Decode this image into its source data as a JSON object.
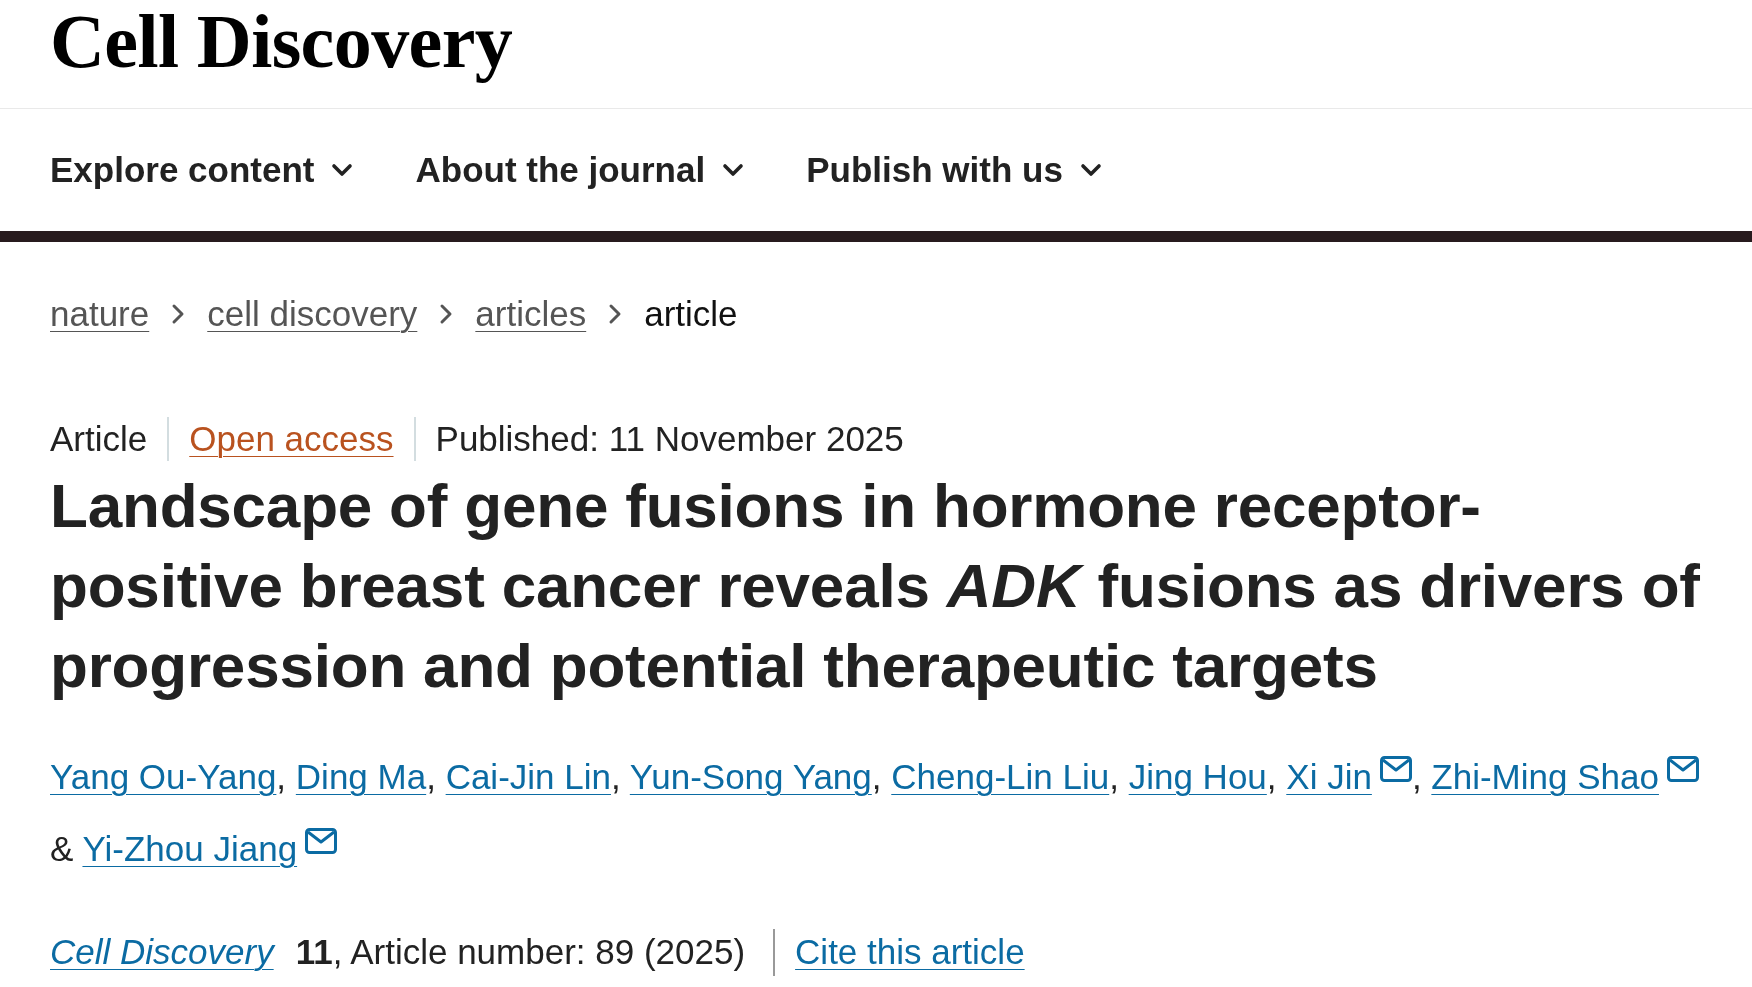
{
  "header": {
    "logo": "Cell Discovery"
  },
  "nav": [
    {
      "label": "Explore content"
    },
    {
      "label": "About the journal"
    },
    {
      "label": "Publish with us"
    }
  ],
  "breadcrumbs": [
    {
      "label": "nature",
      "current": false
    },
    {
      "label": "cell discovery",
      "current": false
    },
    {
      "label": "articles",
      "current": false
    },
    {
      "label": "article",
      "current": true
    }
  ],
  "article": {
    "meta": [
      {
        "kind": "type",
        "text": "Article"
      },
      {
        "kind": "access",
        "text": "Open access"
      },
      {
        "kind": "date",
        "text": "Published: 11 November 2025"
      }
    ],
    "title": "Landscape of gene fusions in hormone receptor-positive breast cancer reveals *ADK* fusions as drivers of progression and potential therapeutic targets",
    "authors": [
      {
        "name": "Yang Ou-Yang",
        "email": false,
        "separator": ","
      },
      {
        "name": "Ding Ma",
        "email": false,
        "separator": ","
      },
      {
        "name": "Cai-Jin Lin",
        "email": false,
        "separator": ","
      },
      {
        "name": "Yun-Song Yang",
        "email": false,
        "separator": ","
      },
      {
        "name": "Cheng-Lin Liu",
        "email": false,
        "separator": ","
      },
      {
        "name": "Jing Hou",
        "email": false,
        "separator": ","
      },
      {
        "name": "Xi Jin",
        "email": true,
        "separator": ","
      },
      {
        "name": "Zhi-Ming Shao",
        "email": true
      },
      {
        "name": "Yi-Zhou Jiang",
        "email": true,
        "joiner": "&"
      }
    ],
    "citation": {
      "journal": "Cell Discovery",
      "details": "**11**, Article number: 89 (2025)",
      "cite_link": "Cite this article"
    }
  }
}
